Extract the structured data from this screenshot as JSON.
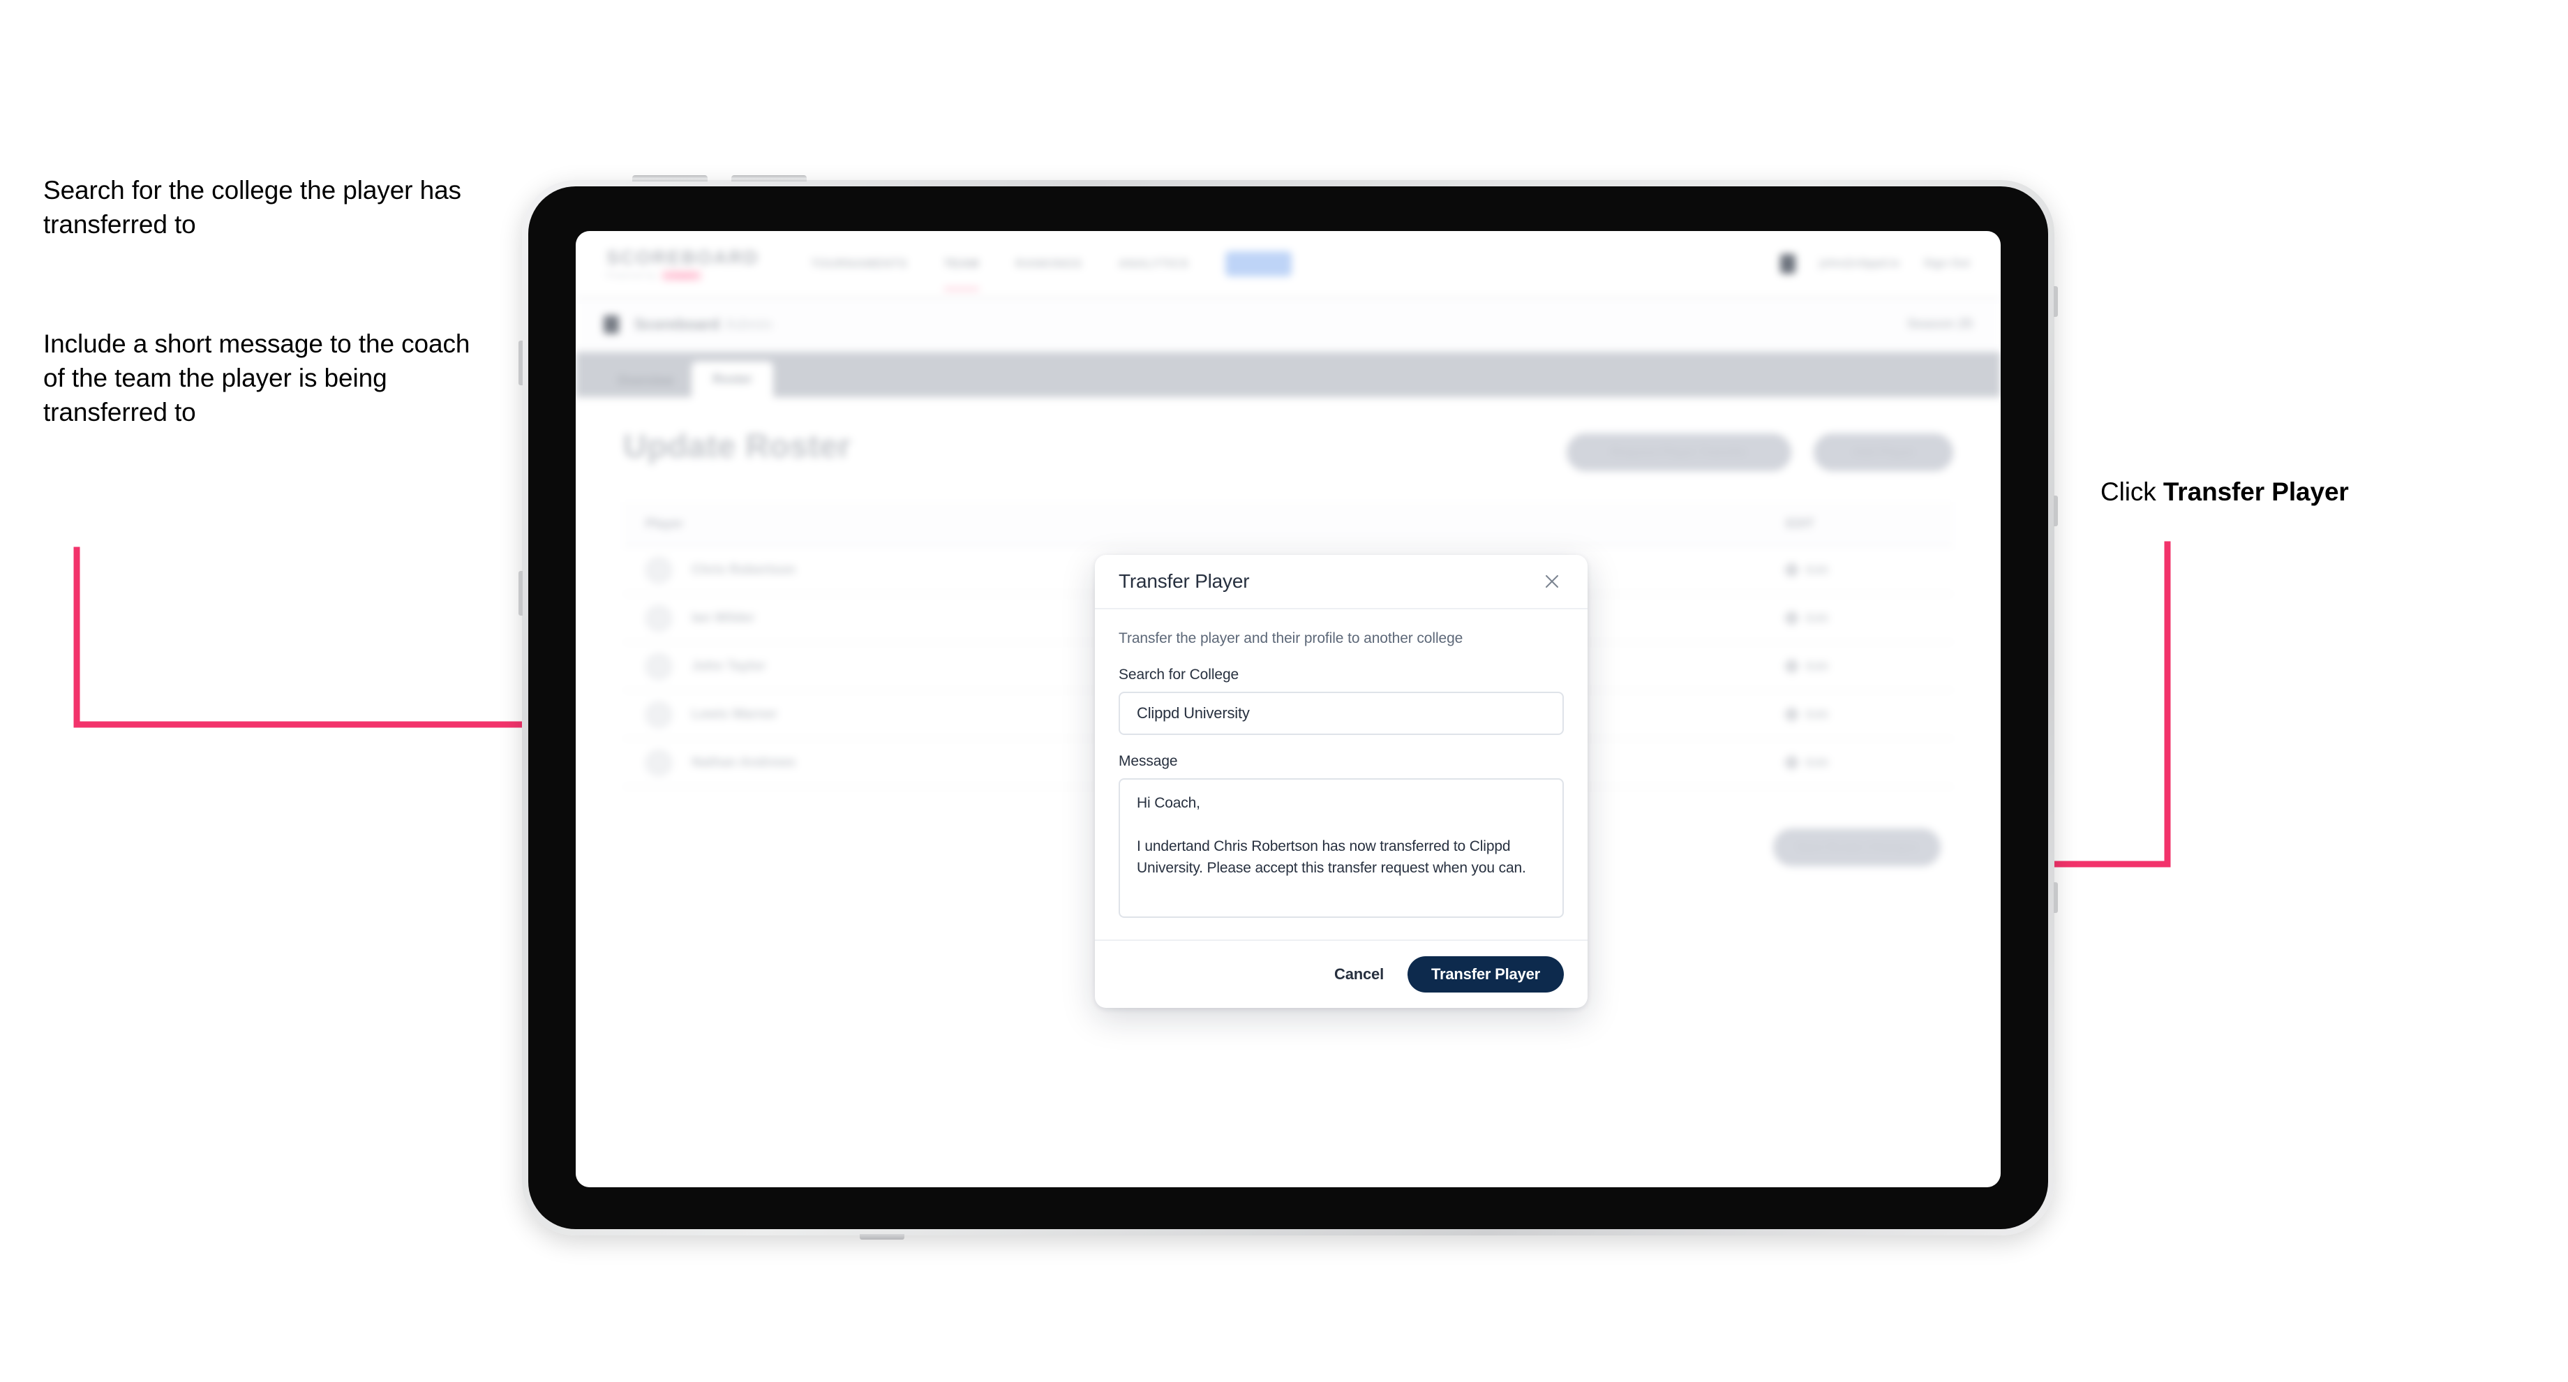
{
  "annotations": {
    "left_1": "Search for the college the player has transferred to",
    "left_2": "Include a short message to the coach of the team the player is being transferred to",
    "right_prefix": "Click ",
    "right_bold": "Transfer Player"
  },
  "colors": {
    "arrow_pink": "#F2336B",
    "primary_navy": "#0D2A4D",
    "text_dark": "#27303F",
    "text_muted": "#5D6878",
    "border": "#DFE3E9"
  },
  "app": {
    "brand": {
      "main": "SCOREBOARD",
      "sub": "Powered by",
      "sub_pill": "clippd"
    },
    "nav": {
      "links": [
        "TOURNAMENTS",
        "TEAM",
        "RANKINGS",
        "ANALYTICS"
      ],
      "active_index": 1,
      "pill_label": "ADMIN",
      "user_name": "john@clippd.io",
      "sign_out": "Sign Out"
    },
    "subbar": {
      "title": "Scoreboard",
      "title_muted": "Admin",
      "right_label": "Season 25"
    },
    "tabs": {
      "items": [
        "Overview",
        "Roster"
      ],
      "selected_index": 1
    },
    "page_title": "Update Roster",
    "header_buttons": [
      "Request Player Transfer",
      "Add Player"
    ],
    "table": {
      "columns": [
        "Player",
        "EDIT"
      ],
      "rows": [
        {
          "name": "Chris Robertson",
          "action": "Edit"
        },
        {
          "name": "Ian Wilder",
          "action": "Edit"
        },
        {
          "name": "John Taylor",
          "action": "Edit"
        },
        {
          "name": "Lewis Warner",
          "action": "Edit"
        },
        {
          "name": "Nathan Andrews",
          "action": "Edit"
        }
      ]
    },
    "bottom_button": "Save Roster Changes"
  },
  "modal": {
    "title": "Transfer Player",
    "close_icon": "close-icon",
    "description": "Transfer the player and their profile to another college",
    "search_label": "Search for College",
    "search_value": "Clippd University",
    "search_placeholder": "Search for College",
    "message_label": "Message",
    "message_value": "Hi Coach,\n\nI undertand Chris Robertson has now transferred to Clippd University. Please accept this transfer request when you can.",
    "message_placeholder": "Message",
    "cancel_label": "Cancel",
    "submit_label": "Transfer Player"
  }
}
